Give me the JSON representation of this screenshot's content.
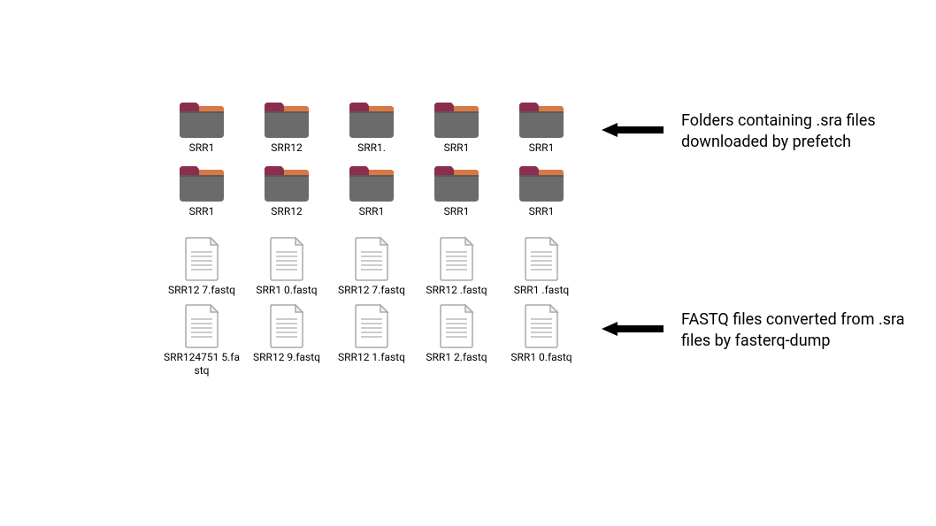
{
  "folders": [
    {
      "label": "SRR1"
    },
    {
      "label": "SRR12"
    },
    {
      "label": "SRR1."
    },
    {
      "label": "SRR1"
    },
    {
      "label": "SRR1"
    },
    {
      "label": "SRR1"
    },
    {
      "label": "SRR12"
    },
    {
      "label": "SRR1"
    },
    {
      "label": "SRR1"
    },
    {
      "label": "SRR1"
    }
  ],
  "files": [
    {
      "label": "SRR12  7.fastq"
    },
    {
      "label": "SRR1  0.fastq"
    },
    {
      "label": "SRR12  7.fastq"
    },
    {
      "label": "SRR12  .fastq"
    },
    {
      "label": "SRR1  .fastq"
    },
    {
      "label": "SRR124751  5.fastq"
    },
    {
      "label": "SRR12  9.fastq"
    },
    {
      "label": "SRR12  1.fastq"
    },
    {
      "label": "SRR1  2.fastq"
    },
    {
      "label": "SRR1  0.fastq"
    }
  ],
  "annotations": {
    "folders_desc": "Folders containing .sra files downloaded by prefetch",
    "files_desc": "FASTQ files converted from .sra files by fasterq-dump"
  }
}
